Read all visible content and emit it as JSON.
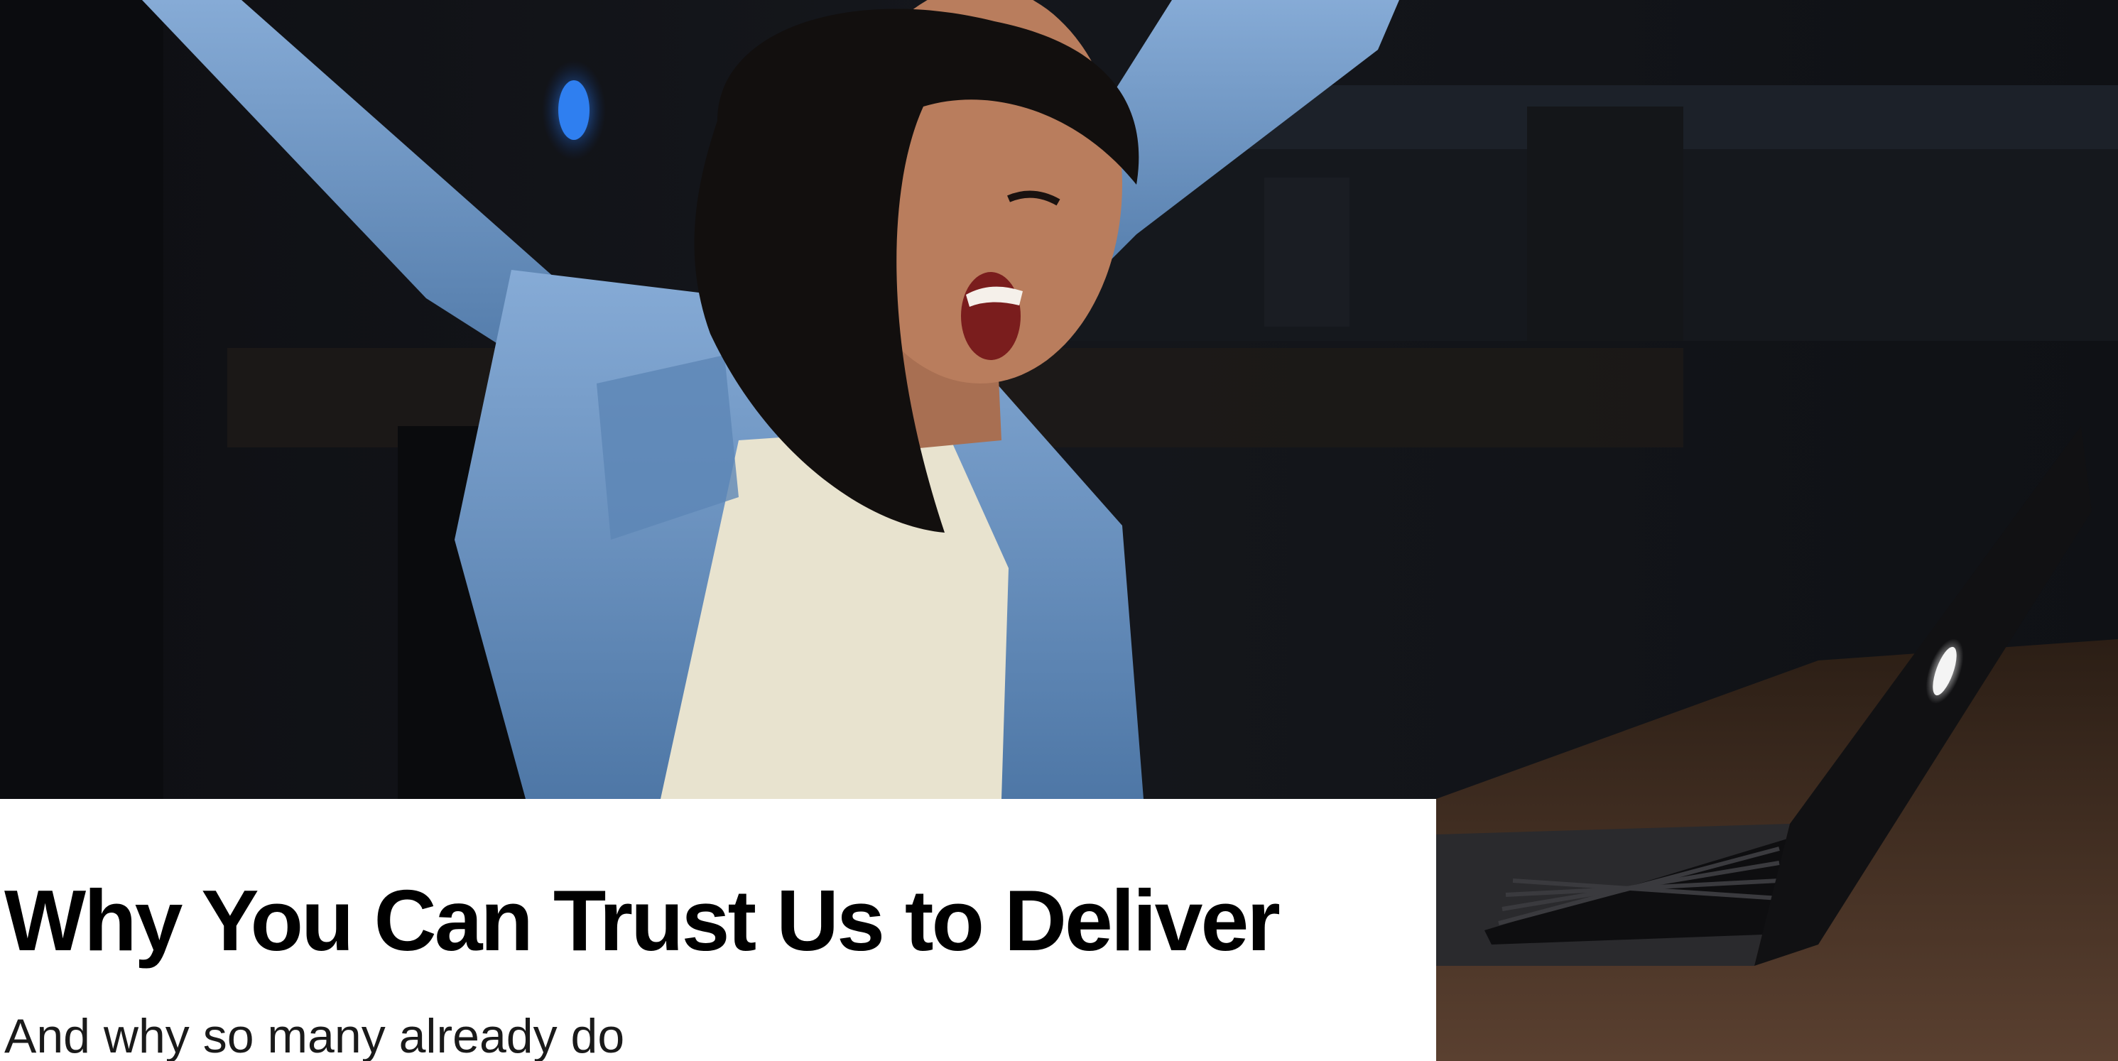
{
  "hero": {
    "title": "Why You Can Trust Us to Deliver",
    "subtitle": "And why so many already do"
  },
  "photo": {
    "subject": "woman celebrating with raised arms in front of a laptop",
    "colors": {
      "background": "#0c0d11",
      "shirt": "#6f97c4",
      "tank_top": "#e8e3cf",
      "skin": "#b97d5d",
      "hair": "#120f0e",
      "laptop": "#101012",
      "desk": "#3a2a1f"
    }
  }
}
